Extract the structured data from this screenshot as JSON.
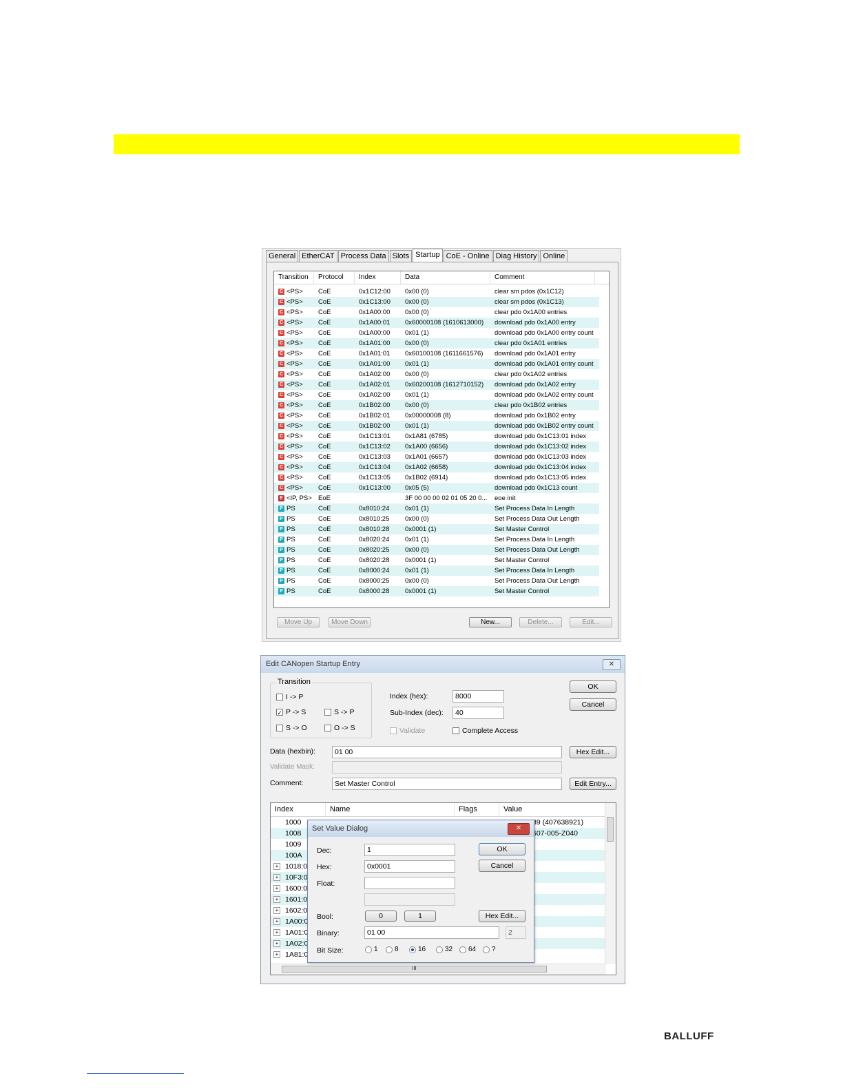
{
  "tabs": [
    {
      "label": "General",
      "active": false
    },
    {
      "label": "EtherCAT",
      "active": false
    },
    {
      "label": "Process Data",
      "active": false
    },
    {
      "label": "Slots",
      "active": false
    },
    {
      "label": "Startup",
      "active": true
    },
    {
      "label": "CoE - Online",
      "active": false
    },
    {
      "label": "Diag History",
      "active": false
    },
    {
      "label": "Online",
      "active": false
    }
  ],
  "startup": {
    "columns": [
      "Transition",
      "Protocol",
      "Index",
      "Data",
      "Comment"
    ],
    "rows": [
      {
        "icon": "C",
        "transition": "<PS>",
        "protocol": "CoE",
        "index": "0x1C12:00",
        "data": "0x00 (0)",
        "comment": "clear sm pdos (0x1C12)"
      },
      {
        "icon": "C",
        "transition": "<PS>",
        "protocol": "CoE",
        "index": "0x1C13:00",
        "data": "0x00 (0)",
        "comment": "clear sm pdos (0x1C13)"
      },
      {
        "icon": "C",
        "transition": "<PS>",
        "protocol": "CoE",
        "index": "0x1A00:00",
        "data": "0x00 (0)",
        "comment": "clear pdo 0x1A00 entries"
      },
      {
        "icon": "C",
        "transition": "<PS>",
        "protocol": "CoE",
        "index": "0x1A00:01",
        "data": "0x60000108 (1610613000)",
        "comment": "download pdo 0x1A00 entry"
      },
      {
        "icon": "C",
        "transition": "<PS>",
        "protocol": "CoE",
        "index": "0x1A00:00",
        "data": "0x01 (1)",
        "comment": "download pdo 0x1A00 entry count"
      },
      {
        "icon": "C",
        "transition": "<PS>",
        "protocol": "CoE",
        "index": "0x1A01:00",
        "data": "0x00 (0)",
        "comment": "clear pdo 0x1A01 entries"
      },
      {
        "icon": "C",
        "transition": "<PS>",
        "protocol": "CoE",
        "index": "0x1A01:01",
        "data": "0x60100108 (1611661576)",
        "comment": "download pdo 0x1A01 entry"
      },
      {
        "icon": "C",
        "transition": "<PS>",
        "protocol": "CoE",
        "index": "0x1A01:00",
        "data": "0x01 (1)",
        "comment": "download pdo 0x1A01 entry count"
      },
      {
        "icon": "C",
        "transition": "<PS>",
        "protocol": "CoE",
        "index": "0x1A02:00",
        "data": "0x00 (0)",
        "comment": "clear pdo 0x1A02 entries"
      },
      {
        "icon": "C",
        "transition": "<PS>",
        "protocol": "CoE",
        "index": "0x1A02:01",
        "data": "0x60200108 (1612710152)",
        "comment": "download pdo 0x1A02 entry"
      },
      {
        "icon": "C",
        "transition": "<PS>",
        "protocol": "CoE",
        "index": "0x1A02:00",
        "data": "0x01 (1)",
        "comment": "download pdo 0x1A02 entry count"
      },
      {
        "icon": "C",
        "transition": "<PS>",
        "protocol": "CoE",
        "index": "0x1B02:00",
        "data": "0x00 (0)",
        "comment": "clear pdo 0x1B02 entries"
      },
      {
        "icon": "C",
        "transition": "<PS>",
        "protocol": "CoE",
        "index": "0x1B02:01",
        "data": "0x00000008 (8)",
        "comment": "download pdo 0x1B02 entry"
      },
      {
        "icon": "C",
        "transition": "<PS>",
        "protocol": "CoE",
        "index": "0x1B02:00",
        "data": "0x01 (1)",
        "comment": "download pdo 0x1B02 entry count"
      },
      {
        "icon": "C",
        "transition": "<PS>",
        "protocol": "CoE",
        "index": "0x1C13:01",
        "data": "0x1A81 (6785)",
        "comment": "download pdo 0x1C13:01 index"
      },
      {
        "icon": "C",
        "transition": "<PS>",
        "protocol": "CoE",
        "index": "0x1C13:02",
        "data": "0x1A00 (6656)",
        "comment": "download pdo 0x1C13:02 index"
      },
      {
        "icon": "C",
        "transition": "<PS>",
        "protocol": "CoE",
        "index": "0x1C13:03",
        "data": "0x1A01 (6657)",
        "comment": "download pdo 0x1C13:03 index"
      },
      {
        "icon": "C",
        "transition": "<PS>",
        "protocol": "CoE",
        "index": "0x1C13:04",
        "data": "0x1A02 (6658)",
        "comment": "download pdo 0x1C13:04 index"
      },
      {
        "icon": "C",
        "transition": "<PS>",
        "protocol": "CoE",
        "index": "0x1C13:05",
        "data": "0x1B02 (6914)",
        "comment": "download pdo 0x1C13:05 index"
      },
      {
        "icon": "C",
        "transition": "<PS>",
        "protocol": "CoE",
        "index": "0x1C13:00",
        "data": "0x05 (5)",
        "comment": "download pdo 0x1C13 count"
      },
      {
        "icon": "E",
        "transition": "<IP, PS>",
        "protocol": "EoE",
        "index": "",
        "data": "3F 00 00 00 02 01 05 20 0...",
        "comment": "eoe init"
      },
      {
        "icon": "P",
        "transition": "PS",
        "protocol": "CoE",
        "index": "0x8010:24",
        "data": "0x01 (1)",
        "comment": "Set Process Data In Length"
      },
      {
        "icon": "P",
        "transition": "PS",
        "protocol": "CoE",
        "index": "0x8010:25",
        "data": "0x00 (0)",
        "comment": "Set Process Data Out Length"
      },
      {
        "icon": "P",
        "transition": "PS",
        "protocol": "CoE",
        "index": "0x8010:28",
        "data": "0x0001 (1)",
        "comment": "Set Master Control"
      },
      {
        "icon": "P",
        "transition": "PS",
        "protocol": "CoE",
        "index": "0x8020:24",
        "data": "0x01 (1)",
        "comment": "Set Process Data In Length"
      },
      {
        "icon": "P",
        "transition": "PS",
        "protocol": "CoE",
        "index": "0x8020:25",
        "data": "0x00 (0)",
        "comment": "Set Process Data Out Length"
      },
      {
        "icon": "P",
        "transition": "PS",
        "protocol": "CoE",
        "index": "0x8020:28",
        "data": "0x0001 (1)",
        "comment": "Set Master Control"
      },
      {
        "icon": "P",
        "transition": "PS",
        "protocol": "CoE",
        "index": "0x8000:24",
        "data": "0x01 (1)",
        "comment": "Set Process Data In Length"
      },
      {
        "icon": "P",
        "transition": "PS",
        "protocol": "CoE",
        "index": "0x8000:25",
        "data": "0x00 (0)",
        "comment": "Set Process Data Out Length"
      },
      {
        "icon": "P",
        "transition": "PS",
        "protocol": "CoE",
        "index": "0x8000:28",
        "data": "0x0001 (1)",
        "comment": "Set Master Control"
      }
    ],
    "buttons": {
      "move_up": "Move Up",
      "move_down": "Move Down",
      "new": "New...",
      "delete": "Delete...",
      "edit": "Edit..."
    }
  },
  "edit_dialog": {
    "title": "Edit CANopen Startup Entry",
    "close": "✕",
    "transition_label": "Transition",
    "checks": {
      "ip": "I -> P",
      "ps": "P -> S",
      "sp": "S -> P",
      "so": "S -> O",
      "os": "O -> S",
      "ps_checked": "✓"
    },
    "index_label": "Index (hex):",
    "index_value": "8000",
    "subindex_label": "Sub-Index (dec):",
    "subindex_value": "40",
    "validate_label": "Validate",
    "complete_access_label": "Complete Access",
    "ok": "OK",
    "cancel": "Cancel",
    "data_label": "Data (hexbin):",
    "data_value": "01 00",
    "validate_mask_label": "Validate Mask:",
    "validate_mask_value": "",
    "comment_label": "Comment:",
    "comment_value": "Set Master Control",
    "hex_edit": "Hex Edit...",
    "edit_entry": "Edit Entry...",
    "tree_columns": [
      "Index",
      "Name",
      "Flags",
      "Value"
    ],
    "tree_rows": [
      {
        "expand": false,
        "index": "1000",
        "value": "89 (407638921)"
      },
      {
        "expand": false,
        "index": "1008",
        "value": "607-005-Z040"
      },
      {
        "expand": false,
        "index": "1009",
        "value": ""
      },
      {
        "expand": false,
        "index": "100A",
        "value": ""
      },
      {
        "expand": true,
        "index": "1018:0",
        "value": ""
      },
      {
        "expand": true,
        "index": "10F3:0",
        "value": ""
      },
      {
        "expand": true,
        "index": "1600:0",
        "value": ""
      },
      {
        "expand": true,
        "index": "1601:0",
        "value": ""
      },
      {
        "expand": true,
        "index": "1602:0",
        "value": ""
      },
      {
        "expand": true,
        "index": "1A00:0",
        "value": ""
      },
      {
        "expand": true,
        "index": "1A01:0",
        "value": ""
      },
      {
        "expand": true,
        "index": "1A02:0",
        "value": ""
      },
      {
        "expand": true,
        "index": "1A81:0",
        "value": ""
      }
    ],
    "scroll_thumb": "III"
  },
  "set_value": {
    "title": "Set Value Dialog",
    "close": "✕",
    "dec_label": "Dec:",
    "dec_value": "1",
    "hex_label": "Hex:",
    "hex_value": "0x0001",
    "float_label": "Float:",
    "float_value": "",
    "bool_label": "Bool:",
    "bool_0": "0",
    "bool_1": "1",
    "binary_label": "Binary:",
    "binary_value": "01 00",
    "binary_size": "2",
    "bitsize_label": "Bit Size:",
    "bitsizes": [
      "1",
      "8",
      "16",
      "32",
      "64",
      "?"
    ],
    "selected_bitsize": "16",
    "ok": "OK",
    "cancel": "Cancel",
    "hex_edit": "Hex Edit..."
  },
  "footer": {
    "logo": "BALLUFF"
  }
}
